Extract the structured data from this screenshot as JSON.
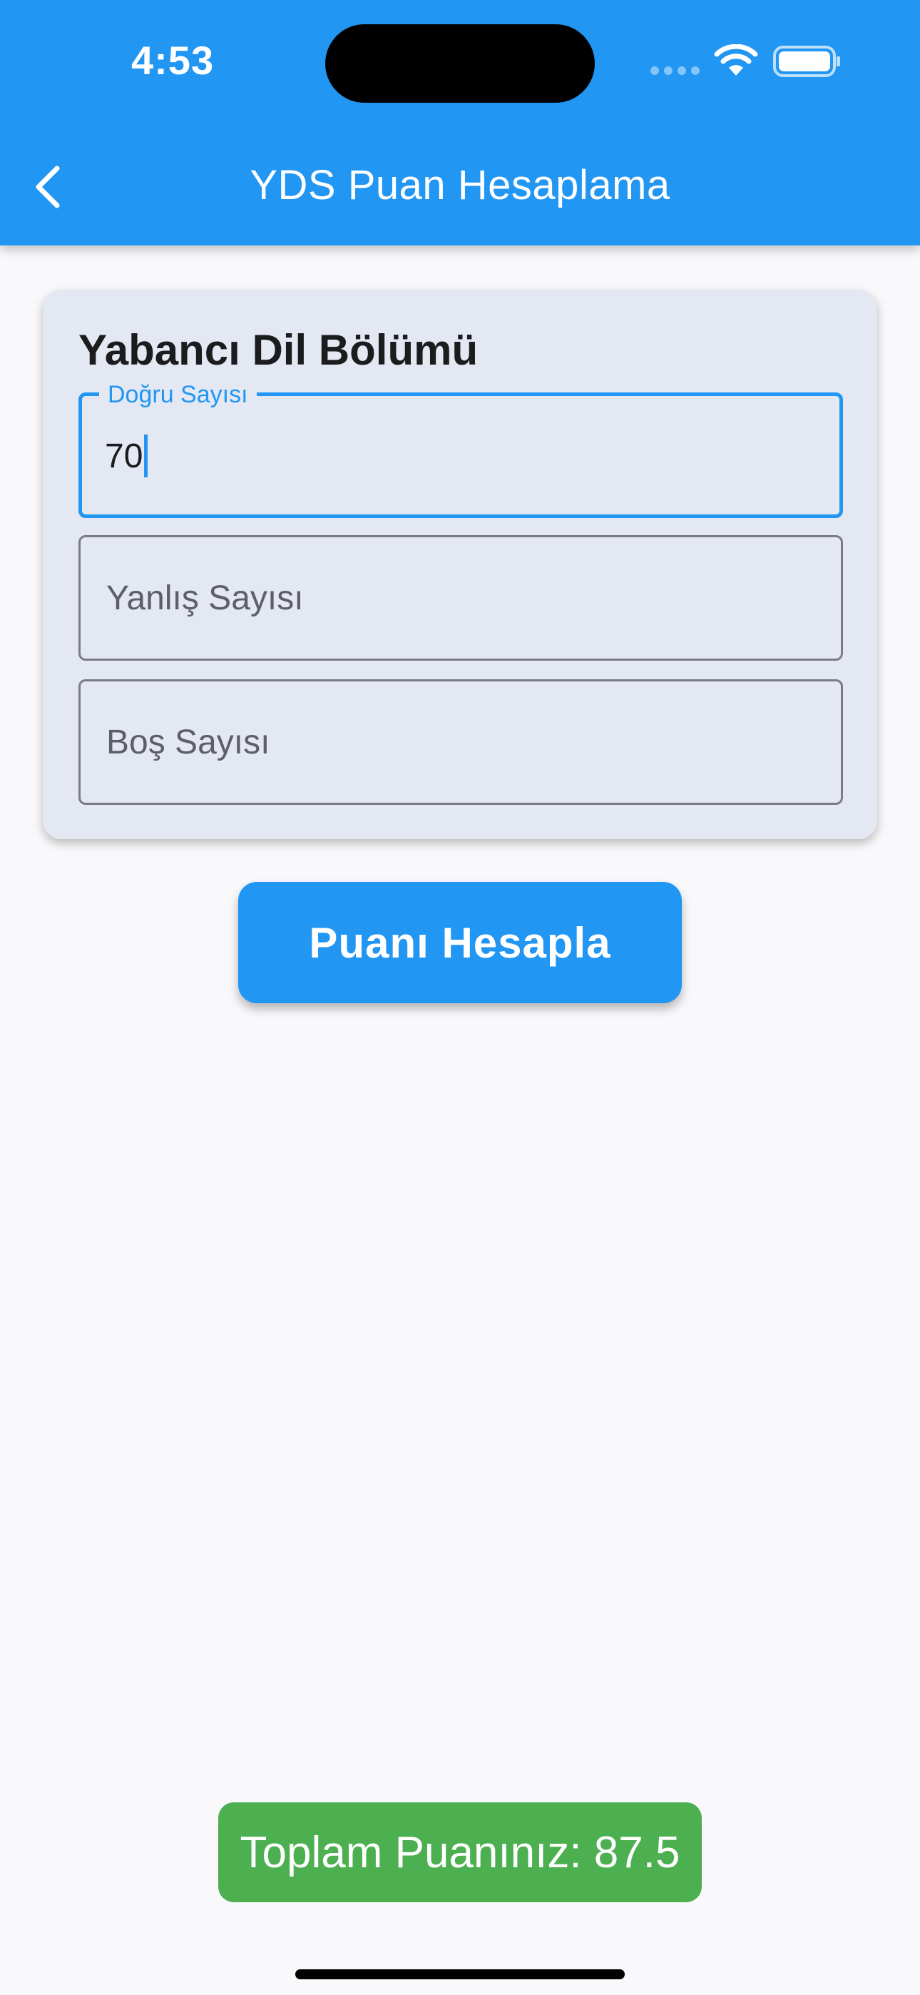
{
  "status_bar": {
    "time": "4:53",
    "icons": [
      "cellular-signal-icon",
      "wifi-icon",
      "battery-icon"
    ]
  },
  "app_bar": {
    "title": "YDS Puan Hesaplama",
    "back_icon": "chevron-left-icon",
    "color": "#2196f3"
  },
  "section": {
    "title": "Yabancı Dil Bölümü",
    "fields": {
      "correct": {
        "label": "Doğru Sayısı",
        "value": "70"
      },
      "wrong": {
        "placeholder": "Yanlış Sayısı",
        "value": ""
      },
      "empty": {
        "placeholder": "Boş Sayısı",
        "value": ""
      }
    }
  },
  "calculate_button": {
    "label": "Puanı Hesapla"
  },
  "result": {
    "text": "Toplam Puanınız: 87.5",
    "color": "#4caf50"
  }
}
